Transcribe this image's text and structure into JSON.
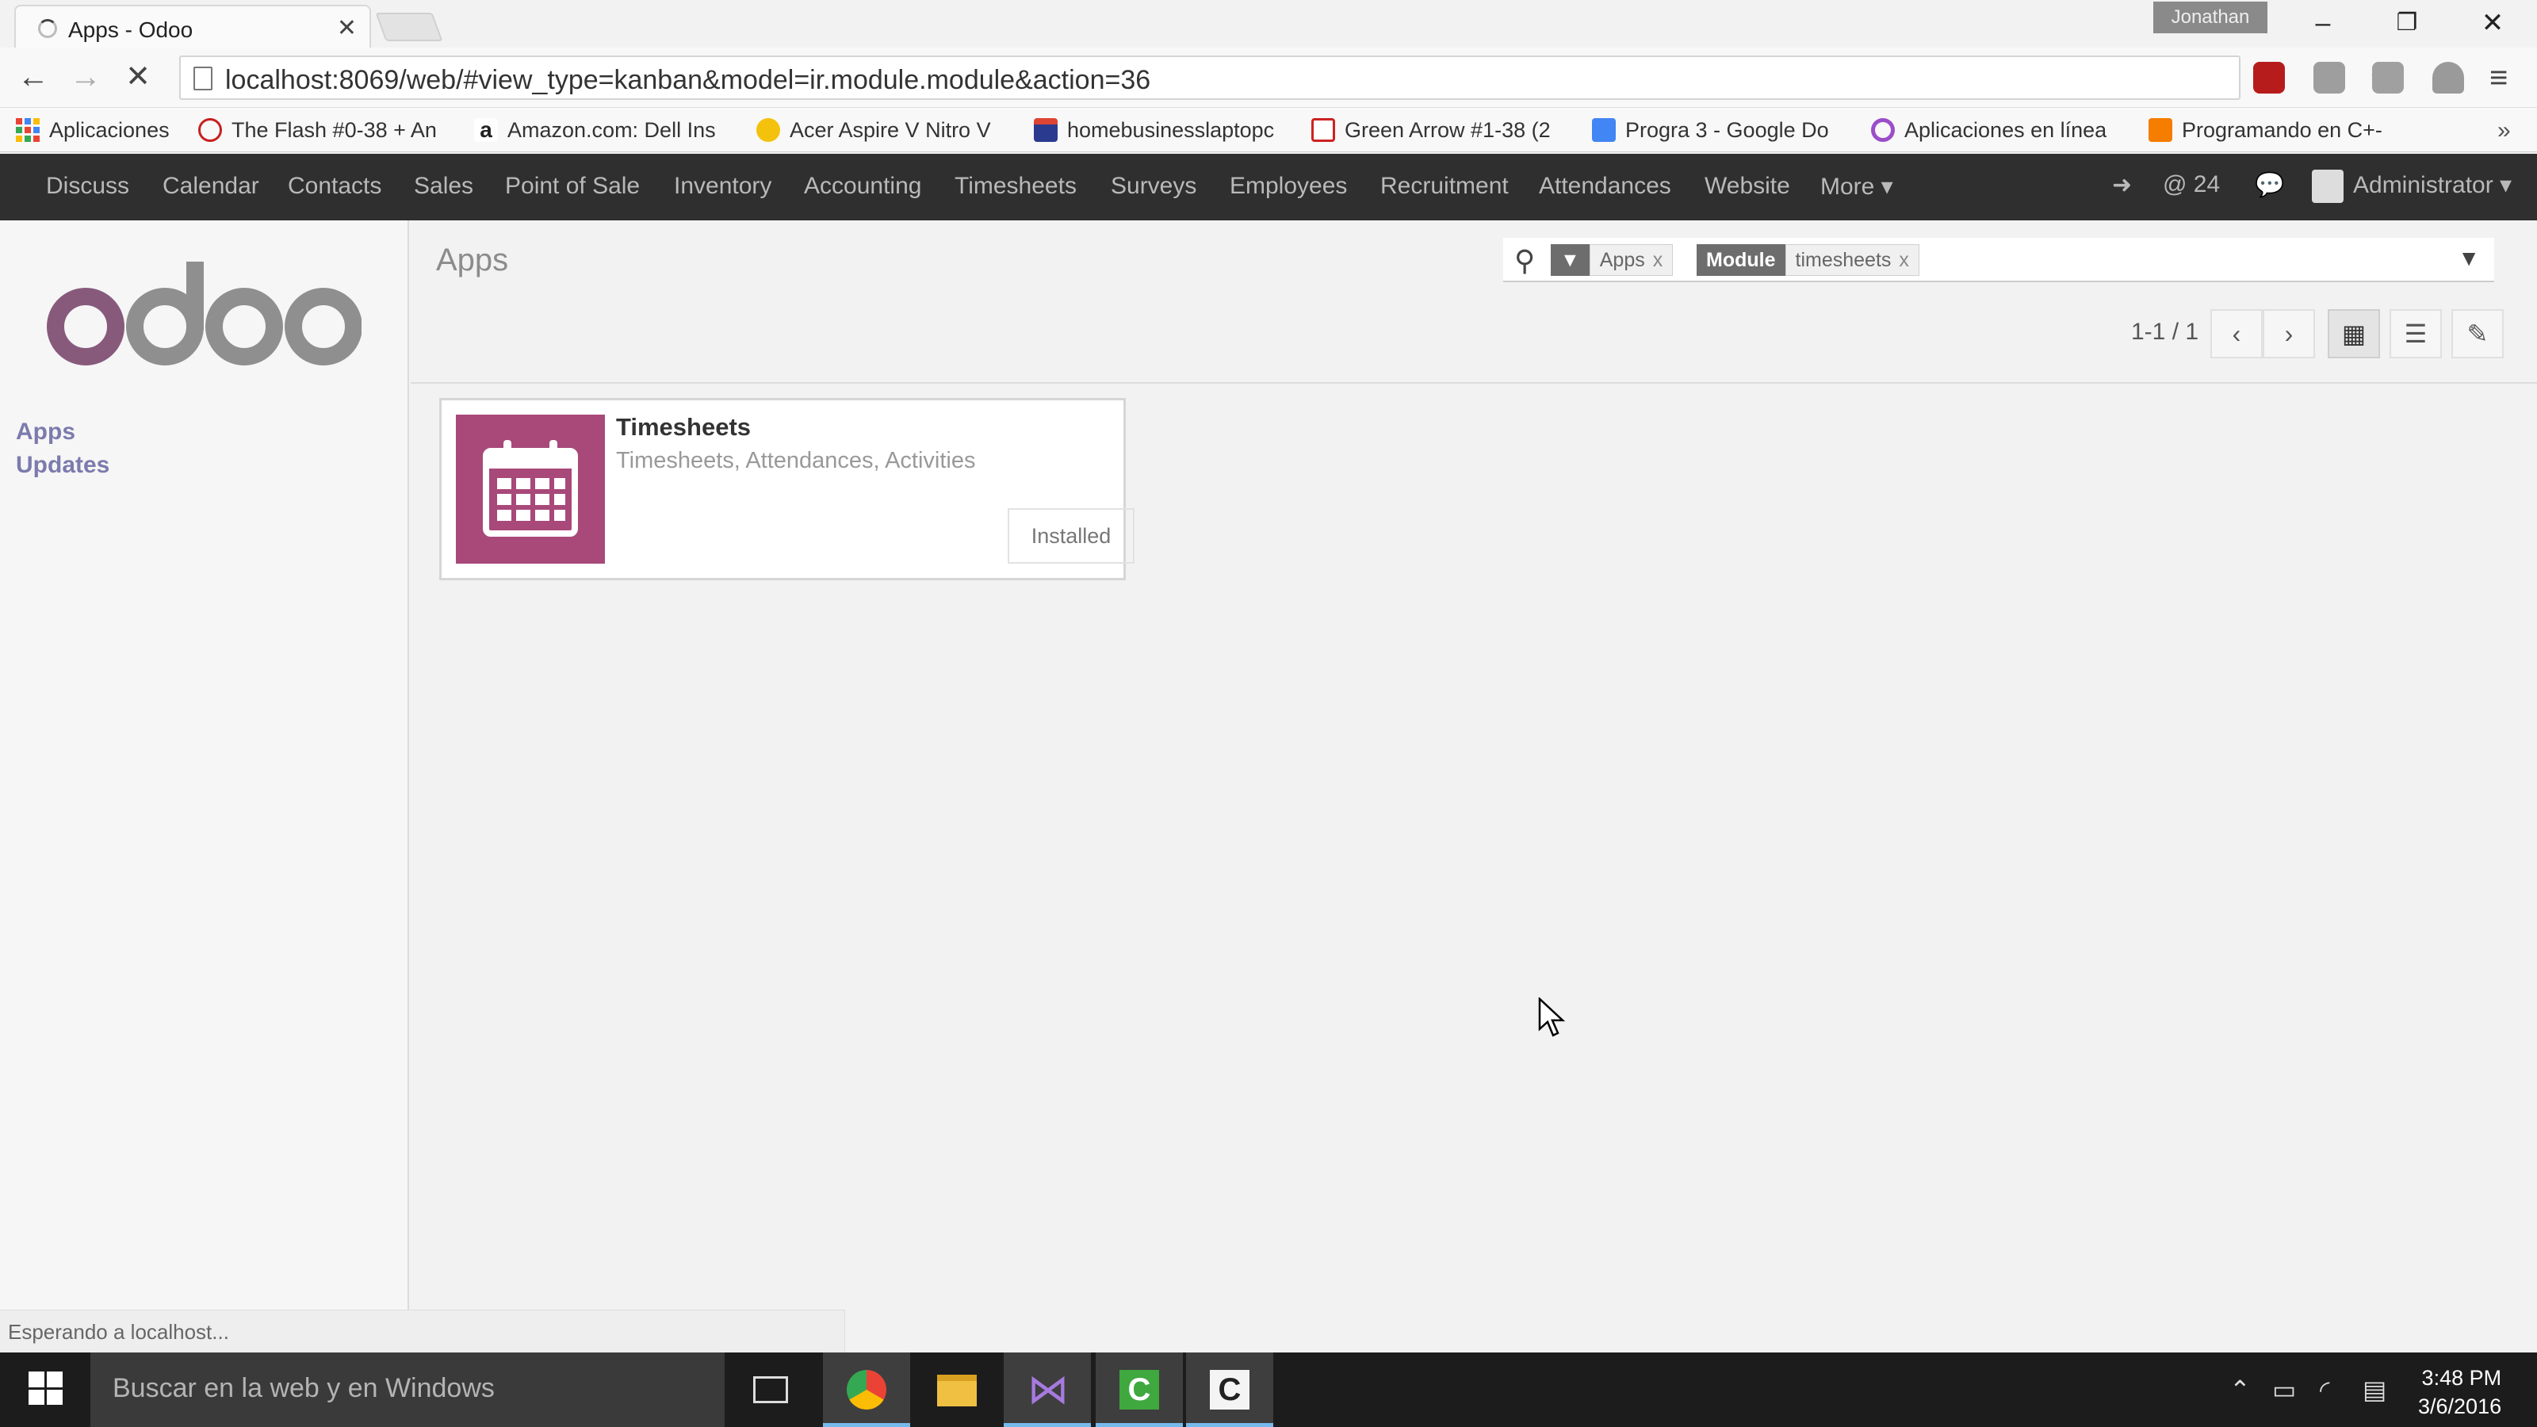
{
  "browser": {
    "tab_title": "Apps - Odoo",
    "tab_close": "✕",
    "user": "Jonathan",
    "url": "localhost:8069/web/#view_type=kanban&model=ir.module.module&action=36",
    "window_minimize": "–",
    "window_restore": "❐",
    "window_close": "✕"
  },
  "bookmarks": [
    {
      "label": "Aplicaciones",
      "icon": "apps-grid-icon"
    },
    {
      "label": "The Flash #0-38 + An",
      "icon": "flash-icon",
      "color": "#c81e1e"
    },
    {
      "label": "Amazon.com: Dell Ins",
      "icon": "amazon-icon",
      "color": "#222222"
    },
    {
      "label": "Acer Aspire V Nitro V",
      "icon": "acer-icon",
      "color": "#f4c20d"
    },
    {
      "label": "homebusinesslaptopc",
      "icon": "laptop-icon",
      "color": "#2a3b8f"
    },
    {
      "label": "Green Arrow #1-38 (2",
      "icon": "green-arrow-icon",
      "color": "#cc2222"
    },
    {
      "label": "Progra 3 - Google Do",
      "icon": "google-docs-icon",
      "color": "#4285f4"
    },
    {
      "label": "Aplicaciones en línea",
      "icon": "circle-icon",
      "color": "#9b4dca"
    },
    {
      "label": "Programando en C+-",
      "icon": "blogger-icon",
      "color": "#f57d00"
    }
  ],
  "topnav": {
    "items": [
      "Discuss",
      "Calendar",
      "Contacts",
      "Sales",
      "Point of Sale",
      "Inventory",
      "Accounting",
      "Timesheets",
      "Surveys",
      "Employees",
      "Recruitment",
      "Attendances",
      "Website",
      "More ▾"
    ],
    "mentions": "@ 24",
    "user": "Administrator ▾"
  },
  "sidebar": {
    "links": [
      "Apps",
      "Updates"
    ]
  },
  "control_panel": {
    "breadcrumb": "Apps",
    "facets": [
      {
        "category": "",
        "value": "Apps",
        "remove": "x"
      },
      {
        "category": "Module",
        "value": "timesheets",
        "remove": "x"
      }
    ],
    "pager": "1-1 / 1"
  },
  "kanban": {
    "cards": [
      {
        "title": "Timesheets",
        "summary": "Timesheets, Attendances, Activities",
        "status": "Installed",
        "icon": "calendar-icon",
        "color": "#a8497a"
      }
    ]
  },
  "status_bar": "Esperando a localhost...",
  "taskbar": {
    "search_placeholder": "Buscar en la web y en Windows",
    "time": "3:48 PM",
    "date": "3/6/2016"
  },
  "colors": {
    "odoo_purple": "#875a7b",
    "odoo_grey": "#8f8f8f",
    "nav_dark": "#2f2f2f",
    "link": "#7c7bad"
  }
}
